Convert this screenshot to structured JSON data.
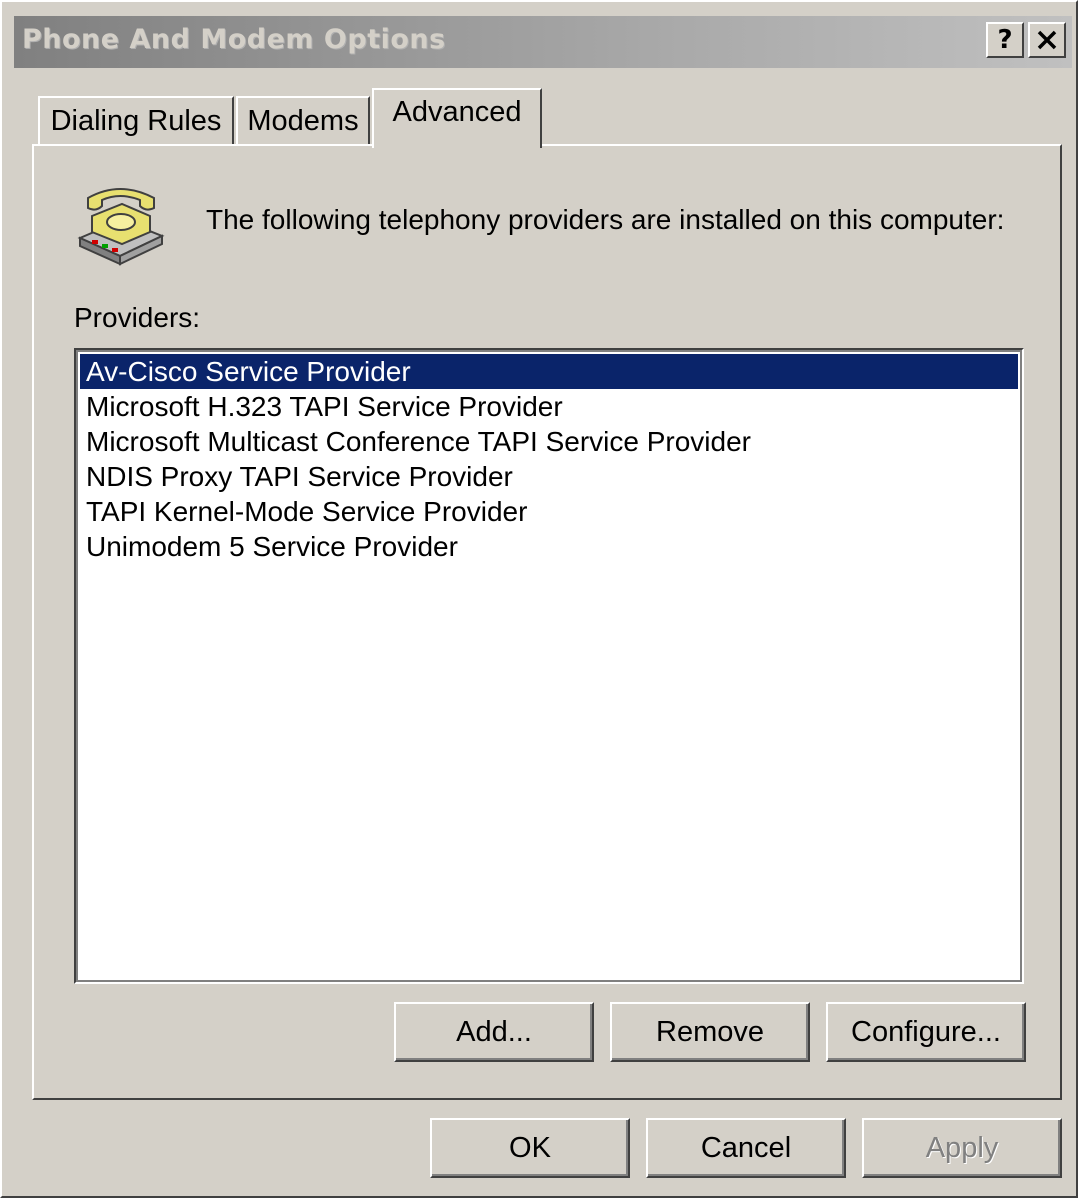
{
  "window": {
    "title": "Phone And Modem Options",
    "help_button": "?",
    "close_button": "✕"
  },
  "tabs": [
    {
      "label": "Dialing Rules",
      "active": false
    },
    {
      "label": "Modems",
      "active": false
    },
    {
      "label": "Advanced",
      "active": true
    }
  ],
  "advanced": {
    "icon": "telephone-icon",
    "header_text": "The following telephony providers are installed on this computer:",
    "providers_label": "Providers:",
    "providers": [
      {
        "label": "Av-Cisco Service Provider",
        "selected": true
      },
      {
        "label": "Microsoft H.323 TAPI Service Provider",
        "selected": false
      },
      {
        "label": "Microsoft Multicast Conference TAPI Service Provider",
        "selected": false
      },
      {
        "label": "NDIS Proxy TAPI Service Provider",
        "selected": false
      },
      {
        "label": "TAPI Kernel-Mode Service Provider",
        "selected": false
      },
      {
        "label": "Unimodem 5 Service Provider",
        "selected": false
      }
    ],
    "buttons": {
      "add": "Add...",
      "remove": "Remove",
      "configure": "Configure..."
    }
  },
  "footer": {
    "ok": "OK",
    "cancel": "Cancel",
    "apply": "Apply",
    "apply_enabled": false
  },
  "colors": {
    "selection": "#0a246a",
    "face": "#d4d0c8"
  }
}
